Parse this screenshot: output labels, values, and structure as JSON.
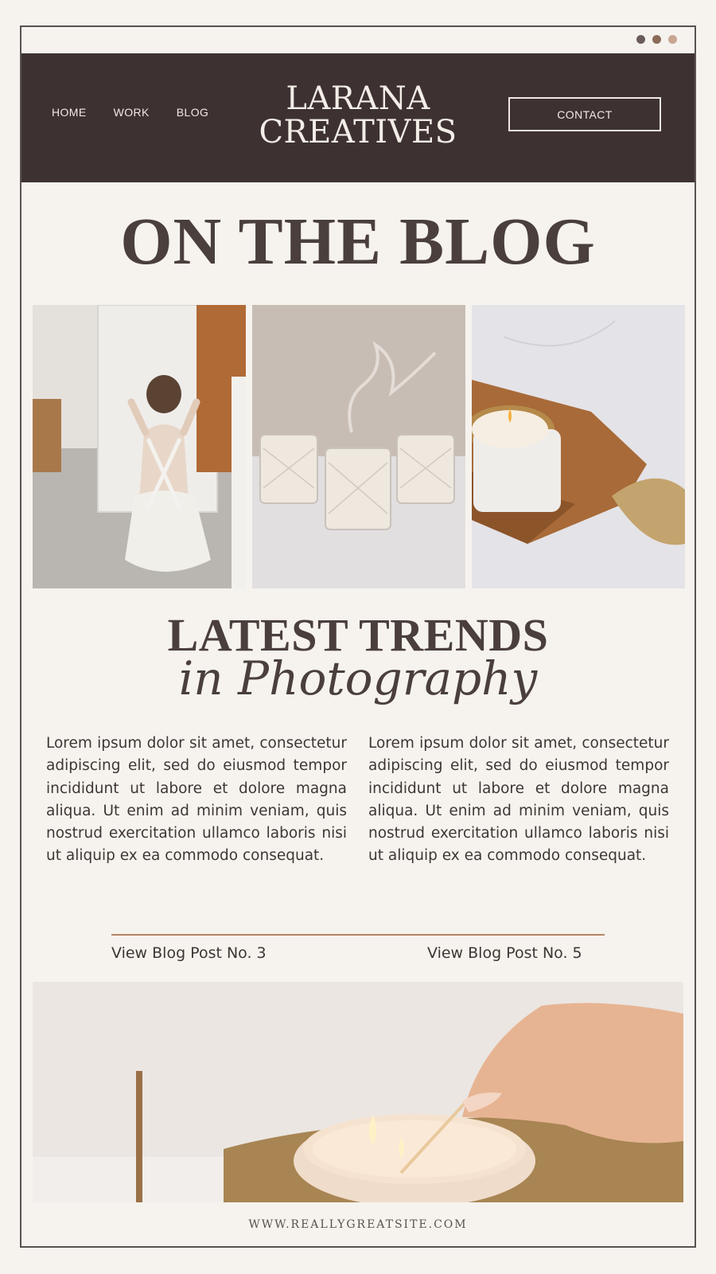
{
  "window": {
    "dots": [
      {
        "name": "dot-1",
        "color": "#6a5c57"
      },
      {
        "name": "dot-2",
        "color": "#8c6a5a"
      },
      {
        "name": "dot-3",
        "color": "#c9a593"
      }
    ]
  },
  "header": {
    "nav": [
      {
        "name": "nav-home",
        "label": "HOME"
      },
      {
        "name": "nav-work",
        "label": "WORK"
      },
      {
        "name": "nav-blog",
        "label": "BLOG"
      }
    ],
    "logo_line1": "LARANA",
    "logo_line2": "CREATIVES",
    "contact_label": "CONTACT",
    "background": "#3d3231"
  },
  "main": {
    "title": "ON THE BLOG",
    "gallery": [
      {
        "name": "photo-woman-mirror",
        "alt": "Woman seated in front of a mirror"
      },
      {
        "name": "photo-glass-candles",
        "alt": "Three crystal glass candles with smoke"
      },
      {
        "name": "photo-candle-tray",
        "alt": "Lit candle on a wooden tray with a brass dish"
      }
    ],
    "section_title": "LATEST TRENDS",
    "section_subtitle": "in Photography",
    "paragraphs": [
      "Lorem ipsum dolor sit amet, consectetur adipiscing elit, sed do eiusmod tempor incididunt ut labore et dolore magna aliqua. Ut enim ad minim veniam, quis nostrud exercitation ullamco laboris nisi ut aliquip ex ea commodo consequat.",
      "Lorem ipsum dolor sit amet, consectetur adipiscing elit, sed do eiusmod tempor incididunt ut labore et dolore magna aliqua. Ut enim ad minim veniam, quis nostrud exercitation ullamco laboris nisi ut aliquip ex ea commodo consequat."
    ],
    "links": [
      {
        "name": "view-post-3-link",
        "label": "View Blog Post No. 3"
      },
      {
        "name": "view-post-5-link",
        "label": "View Blog Post No. 5"
      }
    ],
    "accent_color": "#b38563",
    "wide_photo": {
      "name": "photo-lighting-candle",
      "alt": "Hand lighting a candle with a long match"
    }
  },
  "footer": {
    "url": "WWW.REALLYGREATSITE.COM"
  }
}
